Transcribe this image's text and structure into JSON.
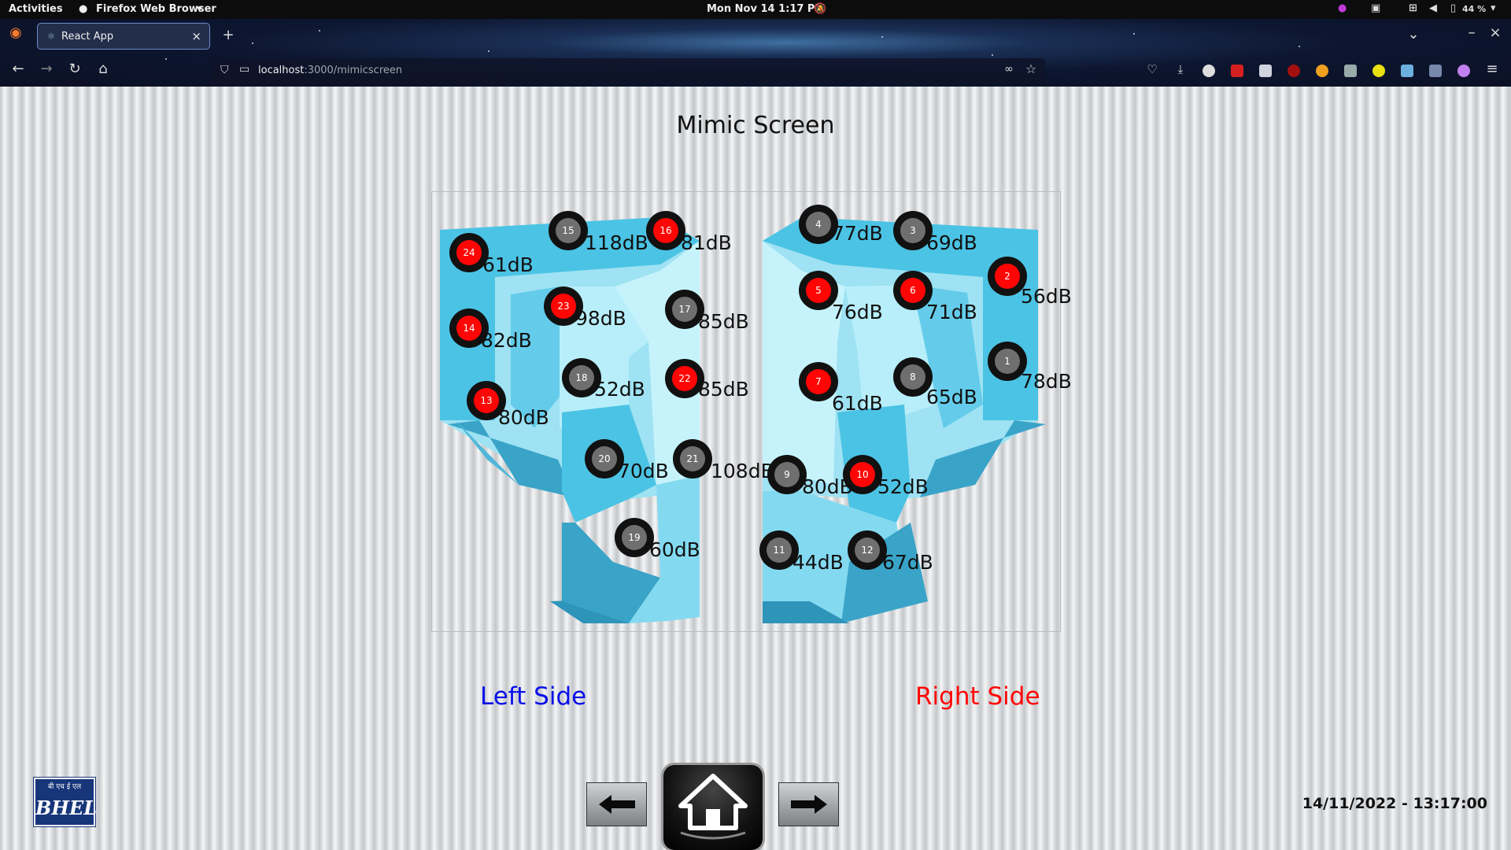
{
  "topbar": {
    "activities": "Activities",
    "app_name": "Firefox Web Browser",
    "clock": "Mon Nov 14  1:17 PM",
    "battery": "44 %"
  },
  "browser": {
    "tab_title": "React App",
    "url_host": "localhost",
    "url_rest": ":3000/mimicscreen"
  },
  "page": {
    "title": "Mimic Screen",
    "left_label": "Left Side",
    "right_label": "Right Side",
    "datetime": "14/11/2022 - 13:17:00",
    "logo_hindi": "बी एच ई एल",
    "logo_text": "BHEL"
  },
  "colors": {
    "alarm": "#ff0505",
    "normal": "#6f6f6f",
    "left_label": "#0a10e8",
    "right_label": "#ff0707"
  },
  "sensors": [
    {
      "id": "24",
      "reading": "61dB",
      "status": "alarm"
    },
    {
      "id": "15",
      "reading": "118dB",
      "status": "normal"
    },
    {
      "id": "16",
      "reading": "81dB",
      "status": "alarm"
    },
    {
      "id": "23",
      "reading": "98dB",
      "status": "alarm"
    },
    {
      "id": "17",
      "reading": "85dB",
      "status": "normal"
    },
    {
      "id": "14",
      "reading": "82dB",
      "status": "alarm"
    },
    {
      "id": "18",
      "reading": "52dB",
      "status": "normal"
    },
    {
      "id": "22",
      "reading": "85dB",
      "status": "alarm"
    },
    {
      "id": "13",
      "reading": "80dB",
      "status": "alarm"
    },
    {
      "id": "20",
      "reading": "70dB",
      "status": "normal"
    },
    {
      "id": "21",
      "reading": "108dB",
      "status": "normal"
    },
    {
      "id": "19",
      "reading": "60dB",
      "status": "normal"
    },
    {
      "id": "4",
      "reading": "77dB",
      "status": "normal"
    },
    {
      "id": "3",
      "reading": "69dB",
      "status": "normal"
    },
    {
      "id": "2",
      "reading": "56dB",
      "status": "alarm"
    },
    {
      "id": "5",
      "reading": "76dB",
      "status": "alarm"
    },
    {
      "id": "6",
      "reading": "71dB",
      "status": "alarm"
    },
    {
      "id": "1",
      "reading": "78dB",
      "status": "normal"
    },
    {
      "id": "7",
      "reading": "61dB",
      "status": "alarm"
    },
    {
      "id": "8",
      "reading": "65dB",
      "status": "normal"
    },
    {
      "id": "9",
      "reading": "80dB",
      "status": "normal"
    },
    {
      "id": "10",
      "reading": "52dB",
      "status": "alarm"
    },
    {
      "id": "11",
      "reading": "44dB",
      "status": "normal"
    },
    {
      "id": "12",
      "reading": "67dB",
      "status": "normal"
    }
  ]
}
